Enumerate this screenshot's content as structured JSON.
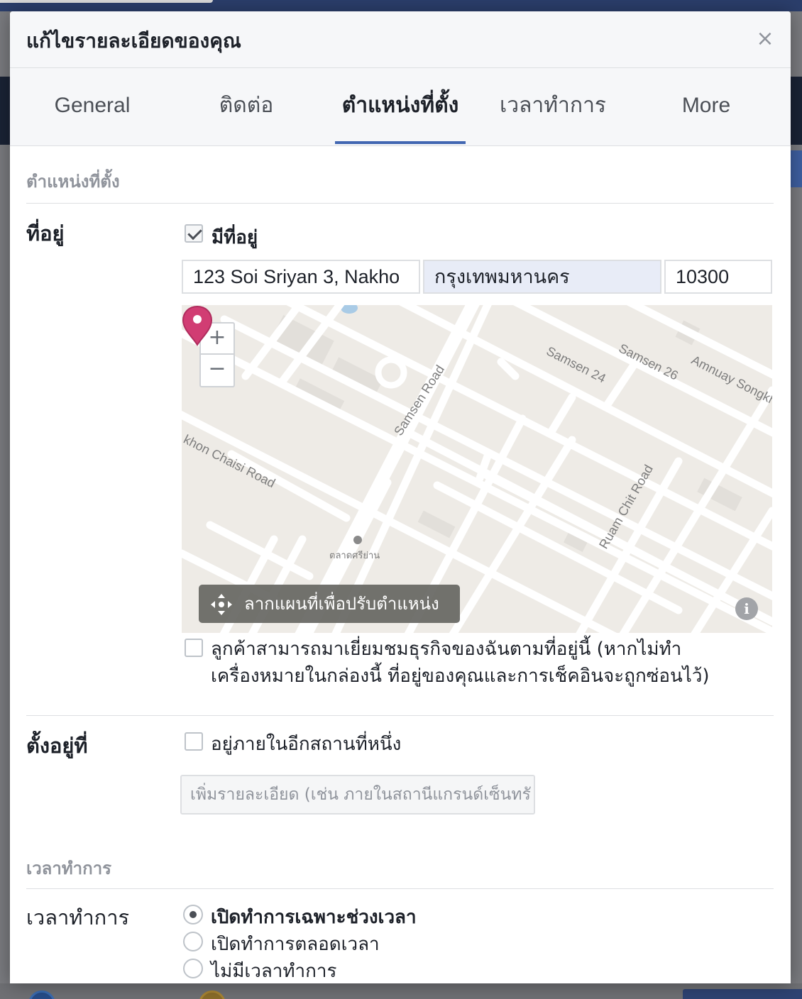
{
  "modal": {
    "title": "แก้ไขรายละเอียดของคุณ",
    "close_glyph": "×"
  },
  "tabs": [
    {
      "label": "General",
      "active": false
    },
    {
      "label": "ติดต่อ",
      "active": false
    },
    {
      "label": "ตำแหน่งที่ตั้ง",
      "active": true
    },
    {
      "label": "เวลาทำการ",
      "active": false
    },
    {
      "label": "More",
      "active": false
    }
  ],
  "location_section": {
    "heading": "ตำแหน่งที่ตั้ง",
    "address_label": "ที่อยู่",
    "has_address_label": "มีที่อยู่",
    "has_address_checked": true,
    "street_value": "123 Soi Sriyan 3, Nakho",
    "city_value": "กรุงเทพมหานคร",
    "zip_value": "10300",
    "map": {
      "zoom_in": "+",
      "zoom_out": "−",
      "drag_hint": "ลากแผนที่เพื่อปรับตำแหน่ง",
      "info": "i",
      "labels": {
        "samsen_road": "Samsen Road",
        "samsen_24": "Samsen 24",
        "samsen_26": "Samsen 26",
        "amnuay": "Amnuay Songkh",
        "nakhon_chaisi": "khon Chaisi Road",
        "ruam_chit": "Ruam Chit Road",
        "market": "ตลาดศรีย่าน"
      }
    },
    "visit_label": "ลูกค้าสามารถมาเยี่ยมชมธุรกิจของฉันตามที่อยู่นี้ (หากไม่ทำ",
    "visit_label_line2": "เครื่องหมายในกล่องนี้ ที่อยู่ของคุณและการเช็คอินจะถูกซ่อนไว้)",
    "visit_checked": false,
    "located_in_label": "ตั้งอยู่ที่",
    "inside_other_label": "อยู่ภายในอีกสถานที่หนึ่ง",
    "inside_other_checked": false,
    "detail_placeholder": "เพิ่มรายละเอียด (เช่น ภายในสถานีแกรนด์เซ็นทรั"
  },
  "hours_section": {
    "heading": "เวลาทำการ",
    "label": "เวลาทำการ",
    "options": [
      {
        "label": "เปิดทำการเฉพาะช่วงเวลา",
        "checked": true
      },
      {
        "label": "เปิดทำการตลอดเวลา",
        "checked": false
      },
      {
        "label": "ไม่มีเวลาทำการ",
        "checked": false
      }
    ]
  },
  "colors": {
    "accent": "#4267b2",
    "pin": "#d13d73",
    "map_bg": "#eeebe6"
  }
}
